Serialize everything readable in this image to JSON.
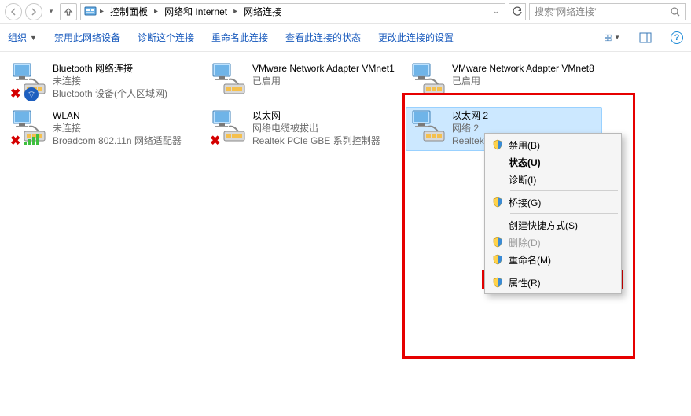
{
  "addressbar": {
    "segments": [
      "控制面板",
      "网络和 Internet",
      "网络连接"
    ],
    "search_placeholder": "搜索\"网络连接\""
  },
  "toolbar": {
    "organize": "组织",
    "items": [
      "禁用此网络设备",
      "诊断这个连接",
      "重命名此连接",
      "查看此连接的状态",
      "更改此连接的设置"
    ]
  },
  "adapters": [
    {
      "name": "Bluetooth 网络连接",
      "status": "未连接",
      "device": "Bluetooth 设备(个人区域网)",
      "disabled_x": true,
      "bt": true,
      "bars": false
    },
    {
      "name": "VMware Network Adapter VMnet1",
      "status": "已启用",
      "device": "",
      "disabled_x": false,
      "bt": false,
      "bars": false
    },
    {
      "name": "VMware Network Adapter VMnet8",
      "status": "已启用",
      "device": "",
      "disabled_x": false,
      "bt": false,
      "bars": false
    },
    {
      "name": "WLAN",
      "status": "未连接",
      "device": "Broadcom 802.11n 网络适配器",
      "disabled_x": true,
      "bt": false,
      "bars": true
    },
    {
      "name": "以太网",
      "status": "网络电缆被拔出",
      "device": "Realtek PCIe GBE 系列控制器",
      "disabled_x": true,
      "bt": false,
      "bars": false
    },
    {
      "name": "以太网 2",
      "status": "网络 2",
      "device": "Realtek",
      "disabled_x": false,
      "bt": false,
      "bars": false,
      "selected": true
    }
  ],
  "context_menu": {
    "items": [
      {
        "label": "禁用(B)",
        "shield": true,
        "bold": false,
        "disabled": false
      },
      {
        "label": "状态(U)",
        "shield": false,
        "bold": true,
        "disabled": false
      },
      {
        "label": "诊断(I)",
        "shield": false,
        "bold": false,
        "disabled": false
      },
      {
        "sep": true
      },
      {
        "label": "桥接(G)",
        "shield": true,
        "bold": false,
        "disabled": false
      },
      {
        "sep": true
      },
      {
        "label": "创建快捷方式(S)",
        "shield": false,
        "bold": false,
        "disabled": false
      },
      {
        "label": "删除(D)",
        "shield": true,
        "bold": false,
        "disabled": true
      },
      {
        "label": "重命名(M)",
        "shield": true,
        "bold": false,
        "disabled": false
      },
      {
        "sep": true
      },
      {
        "label": "属性(R)",
        "shield": true,
        "bold": false,
        "disabled": false,
        "highlight": true
      }
    ]
  }
}
